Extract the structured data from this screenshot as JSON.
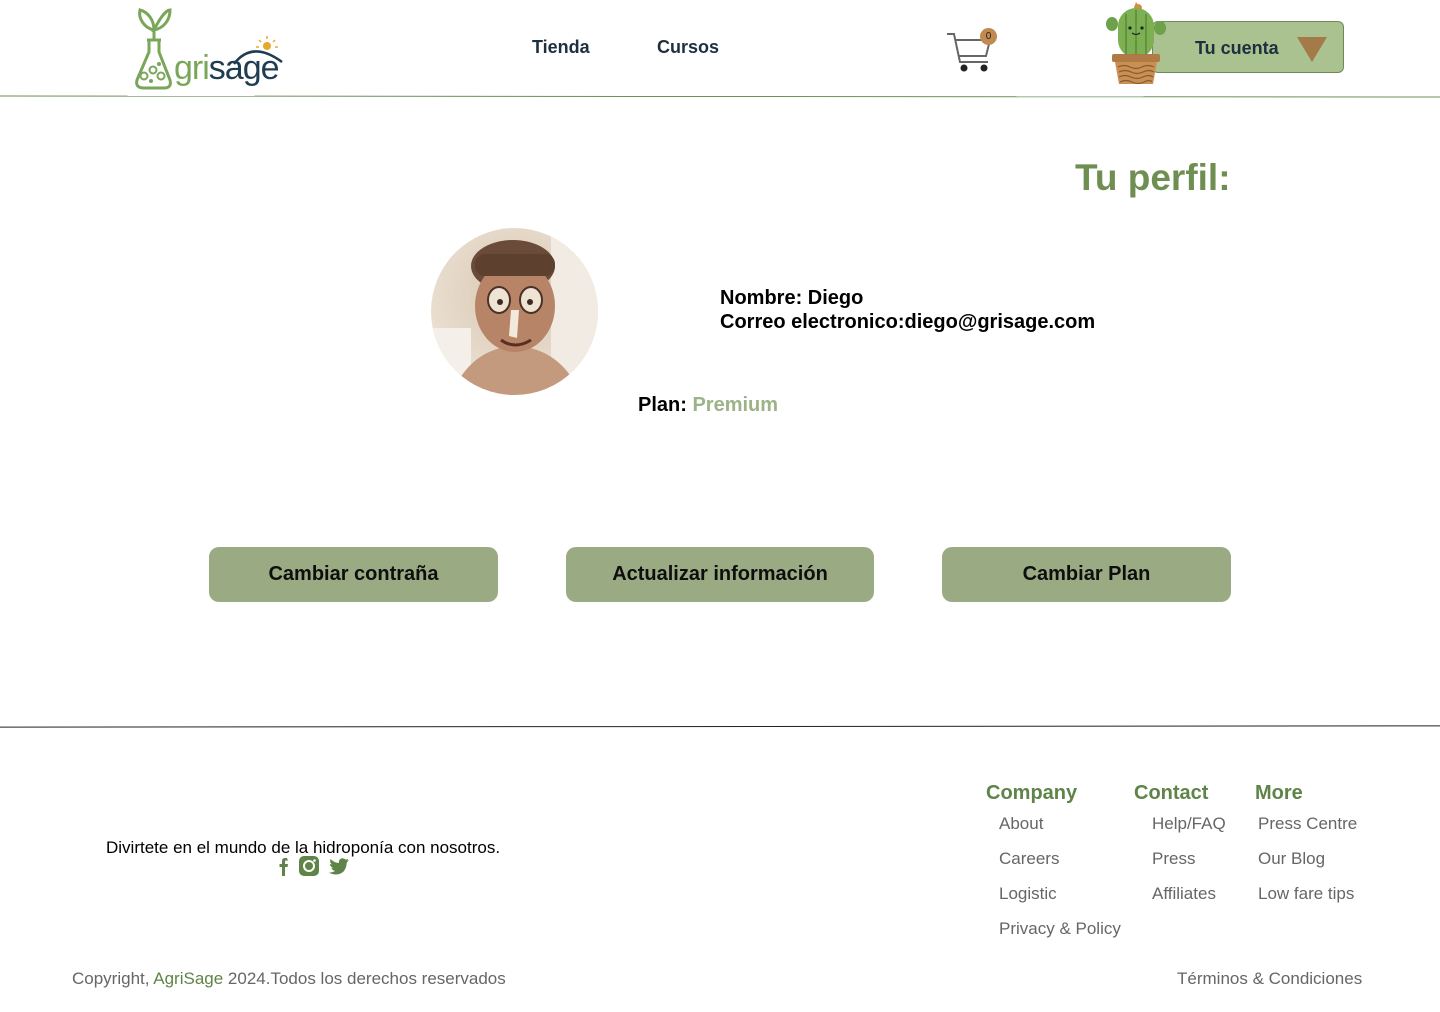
{
  "header": {
    "logo": {
      "text_prefix": "A",
      "text_green": "gri",
      "text_blue": "sage"
    },
    "nav": [
      {
        "label": "Tienda"
      },
      {
        "label": "Cursos"
      }
    ],
    "cart": {
      "count": "0",
      "icon": "cart-icon"
    },
    "account": {
      "label": "Tu cuenta",
      "icon": "caret-down-icon"
    }
  },
  "profile": {
    "title": "Tu perfil:",
    "name_line": "Nombre: Diego",
    "email_line": "Correo electronico:diego@grisage.com",
    "plan_label": "Plan: ",
    "plan_value": "Premium"
  },
  "actions": [
    {
      "label": "Cambiar contraña"
    },
    {
      "label": "Actualizar información"
    },
    {
      "label": "Cambiar Plan"
    }
  ],
  "footer": {
    "tagline": "Divirtete en el mundo de la hidroponía con nosotros.",
    "social": [
      "facebook-icon",
      "instagram-icon",
      "twitter-icon"
    ],
    "columns": [
      {
        "heading": "Company",
        "links": [
          "About",
          "Careers",
          "Logistic",
          "Privacy & Policy"
        ]
      },
      {
        "heading": "Contact",
        "links": [
          "Help/FAQ",
          "Press",
          "Affiliates"
        ]
      },
      {
        "heading": "More",
        "links": [
          "Press Centre",
          "Our Blog",
          "Low fare tips"
        ]
      }
    ],
    "copyright_prefix": "Copyright, ",
    "copyright_brand": "AgriSage",
    "copyright_suffix": " 2024.Todos los derechos reservados",
    "terms": "Términos & Condiciones"
  },
  "colors": {
    "brand_green": "#6f8f52",
    "button_green": "#9aab84",
    "account_green": "#a9c290",
    "accent_brown": "#a47a48"
  }
}
